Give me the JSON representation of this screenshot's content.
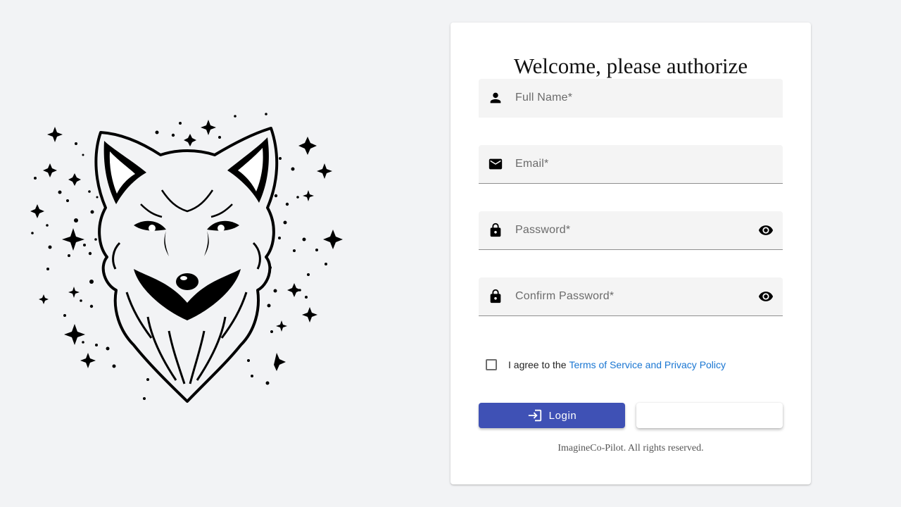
{
  "logo": {
    "name": "fox-head-illustration"
  },
  "form": {
    "title": "Welcome, please authorize",
    "fields": {
      "full_name": {
        "placeholder": "Full Name*",
        "icon": "person-icon"
      },
      "email": {
        "placeholder": "Email*",
        "icon": "mail-icon"
      },
      "password": {
        "placeholder": "Password*",
        "icon": "lock-icon",
        "toggle_icon": "eye-icon"
      },
      "confirm_password": {
        "placeholder": "Confirm Password*",
        "icon": "lock-icon",
        "toggle_icon": "eye-icon"
      }
    },
    "agreement": {
      "checked": false,
      "text": "I agree to the",
      "link_text": "Terms of Service and Privacy Policy"
    },
    "buttons": {
      "login_label": "Login",
      "login_icon": "login-icon",
      "secondary_label": ""
    },
    "footer": "ImagineCo-Pilot. All rights reserved."
  },
  "colors": {
    "background": "#f2f3f5",
    "primary": "#3f51b5",
    "link": "#1976d2"
  }
}
